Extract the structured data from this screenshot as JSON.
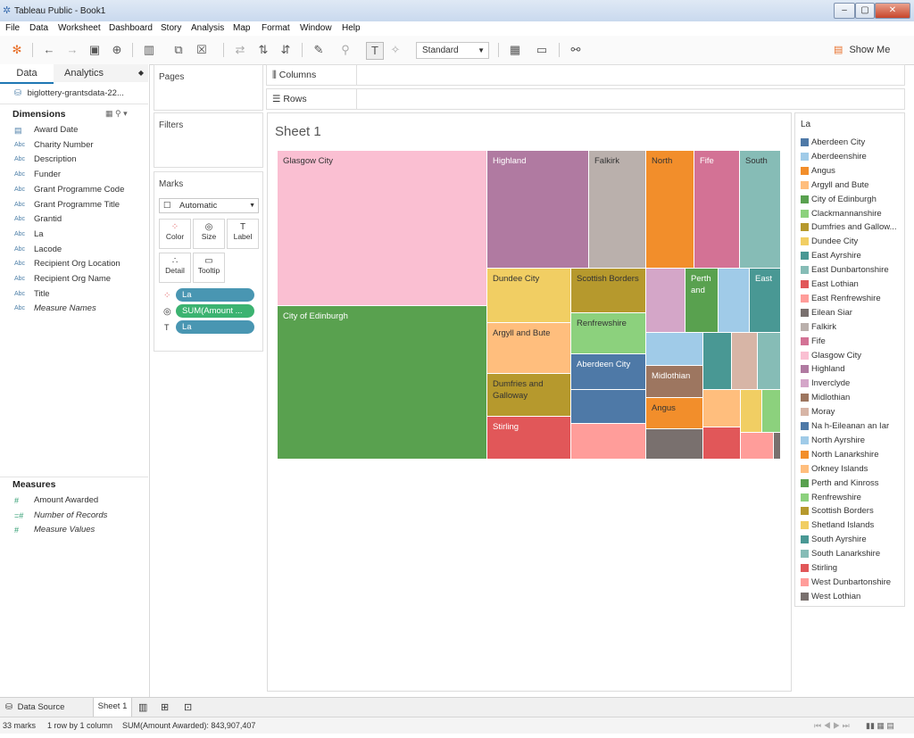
{
  "window": {
    "title": "Tableau Public - Book1",
    "min": "–",
    "max": "▢",
    "close": "✕"
  },
  "menu": [
    "File",
    "Data",
    "Worksheet",
    "Dashboard",
    "Story",
    "Analysis",
    "Map",
    "Format",
    "Window",
    "Help"
  ],
  "toolbar": {
    "fit_select": "Standard",
    "show_me": "Show Me"
  },
  "leftpane": {
    "tab_data": "Data",
    "tab_analytics": "Analytics",
    "datasource": "biglottery-grantsdata-22...",
    "dimensions_title": "Dimensions",
    "dimensions": [
      {
        "type": "date",
        "name": "Award Date"
      },
      {
        "type": "Abc",
        "name": "Charity Number"
      },
      {
        "type": "Abc",
        "name": "Description"
      },
      {
        "type": "Abc",
        "name": "Funder"
      },
      {
        "type": "Abc",
        "name": "Grant Programme Code"
      },
      {
        "type": "Abc",
        "name": "Grant Programme Title"
      },
      {
        "type": "Abc",
        "name": "Grantid"
      },
      {
        "type": "Abc",
        "name": "La"
      },
      {
        "type": "Abc",
        "name": "Lacode"
      },
      {
        "type": "Abc",
        "name": "Recipient Org Location"
      },
      {
        "type": "Abc",
        "name": "Recipient Org Name"
      },
      {
        "type": "Abc",
        "name": "Title"
      },
      {
        "type": "Abc",
        "name": "Measure Names"
      }
    ],
    "measures_title": "Measures",
    "measures": [
      {
        "type": "#",
        "name": "Amount Awarded"
      },
      {
        "type": "=#",
        "name": "Number of Records"
      },
      {
        "type": "#",
        "name": "Measure Values"
      }
    ]
  },
  "shelves": {
    "pages": "Pages",
    "filters": "Filters",
    "marks": "Marks",
    "mark_type": "Automatic",
    "buttons": [
      "Color",
      "Size",
      "Label",
      "Detail",
      "Tooltip"
    ],
    "pills": [
      "La",
      "SUM(Amount ...",
      "La"
    ],
    "columns": "Columns",
    "rows": "Rows"
  },
  "sheet": {
    "title": "Sheet 1"
  },
  "legend": {
    "title": "La",
    "items": [
      {
        "name": "Aberdeen City",
        "color": "#4e79a7"
      },
      {
        "name": "Aberdeenshire",
        "color": "#a0cbe8"
      },
      {
        "name": "Angus",
        "color": "#f28e2b"
      },
      {
        "name": "Argyll and Bute",
        "color": "#ffbe7d"
      },
      {
        "name": "City of Edinburgh",
        "color": "#59a14f"
      },
      {
        "name": "Clackmannanshire",
        "color": "#8cd17d"
      },
      {
        "name": "Dumfries and Gallow...",
        "color": "#b6992d"
      },
      {
        "name": "Dundee City",
        "color": "#f1ce63"
      },
      {
        "name": "East Ayrshire",
        "color": "#499894"
      },
      {
        "name": "East Dunbartonshire",
        "color": "#86bcb6"
      },
      {
        "name": "East Lothian",
        "color": "#e15759"
      },
      {
        "name": "East Renfrewshire",
        "color": "#ff9d9a"
      },
      {
        "name": "Eilean Siar",
        "color": "#79706e"
      },
      {
        "name": "Falkirk",
        "color": "#bab0ac"
      },
      {
        "name": "Fife",
        "color": "#d37295"
      },
      {
        "name": "Glasgow City",
        "color": "#fabfd2"
      },
      {
        "name": "Highland",
        "color": "#b07aa1"
      },
      {
        "name": "Inverclyde",
        "color": "#d4a6c8"
      },
      {
        "name": "Midlothian",
        "color": "#9d7660"
      },
      {
        "name": "Moray",
        "color": "#d7b5a6"
      },
      {
        "name": "Na h-Eileanan an Iar",
        "color": "#4e79a7"
      },
      {
        "name": "North Ayrshire",
        "color": "#a0cbe8"
      },
      {
        "name": "North Lanarkshire",
        "color": "#f28e2b"
      },
      {
        "name": "Orkney Islands",
        "color": "#ffbe7d"
      },
      {
        "name": "Perth and Kinross",
        "color": "#59a14f"
      },
      {
        "name": "Renfrewshire",
        "color": "#8cd17d"
      },
      {
        "name": "Scottish Borders",
        "color": "#b6992d"
      },
      {
        "name": "Shetland Islands",
        "color": "#f1ce63"
      },
      {
        "name": "South Ayrshire",
        "color": "#499894"
      },
      {
        "name": "South Lanarkshire",
        "color": "#86bcb6"
      },
      {
        "name": "Stirling",
        "color": "#e15759"
      },
      {
        "name": "West Dunbartonshire",
        "color": "#ff9d9a"
      },
      {
        "name": "West Lothian",
        "color": "#79706e"
      }
    ]
  },
  "treemap_labels": [
    "Glasgow City",
    "City of Edinburgh",
    "Highland",
    "Falkirk",
    "North",
    "Fife",
    "South",
    "Dundee City",
    "Argyll and Bute",
    "Dumfries and Galloway",
    "Stirling",
    "Scottish Borders",
    "Renfrewshire",
    "Aberdeen City",
    "Perth and",
    "East",
    "Midlothian",
    "Angus"
  ],
  "bottom": {
    "datasource_tab": "Data Source",
    "sheet_tab": "Sheet 1"
  },
  "status": {
    "marks": "33 marks",
    "rows": "1 row by 1 column",
    "sum": "SUM(Amount Awarded): 843,907,407"
  }
}
